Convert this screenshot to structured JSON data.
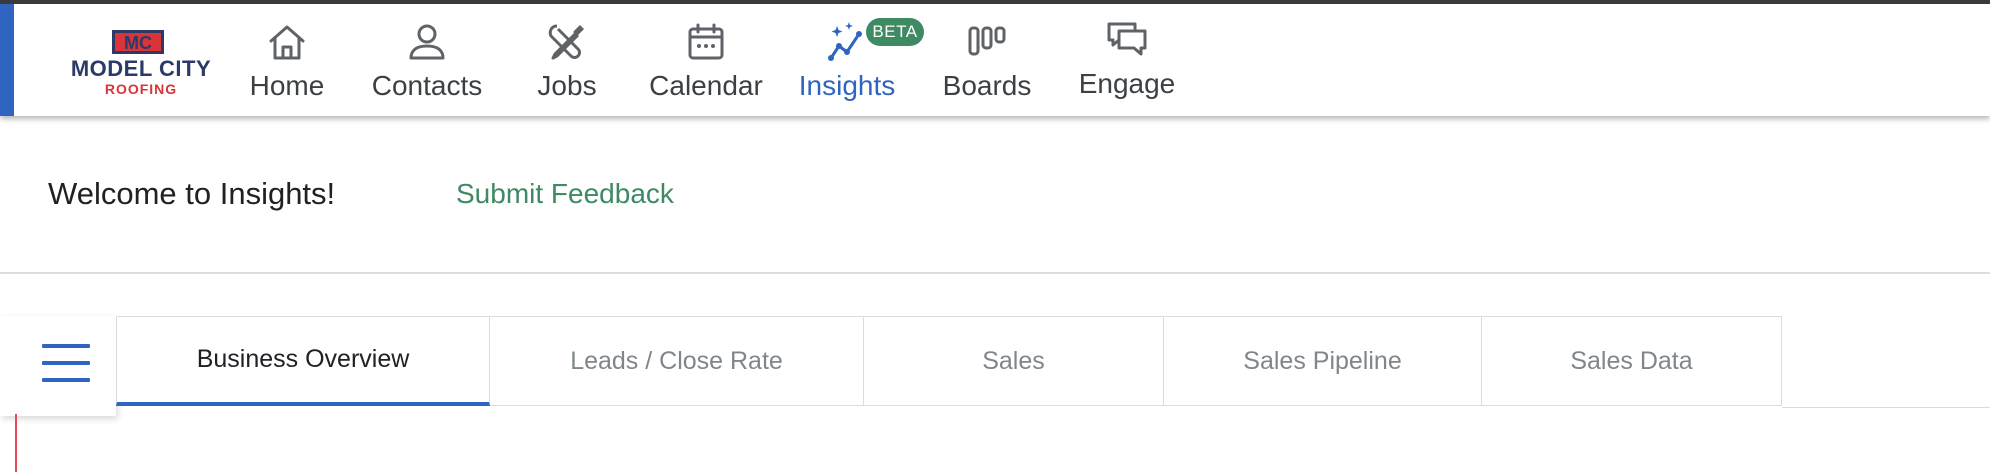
{
  "brand": {
    "logo_mark": "MC",
    "logo_line1": "MODEL CITY",
    "logo_line2": "ROOFING",
    "colors": {
      "navy": "#2b3a67",
      "red": "#d9343a"
    }
  },
  "nav": {
    "items": [
      {
        "label": "Home",
        "icon": "home-icon",
        "active": false
      },
      {
        "label": "Contacts",
        "icon": "person-icon",
        "active": false
      },
      {
        "label": "Jobs",
        "icon": "tools-icon",
        "active": false
      },
      {
        "label": "Calendar",
        "icon": "calendar-icon",
        "active": false
      },
      {
        "label": "Insights",
        "icon": "insights-sparkle-icon",
        "active": true
      },
      {
        "label": "Boards",
        "icon": "boards-icon",
        "active": false
      },
      {
        "label": "Engage",
        "icon": "chat-bubbles-icon",
        "active": false
      }
    ],
    "beta_badge": "BETA"
  },
  "header": {
    "welcome": "Welcome to Insights!",
    "feedback_link": "Submit Feedback"
  },
  "tabs": [
    {
      "label": "Business Overview",
      "active": true
    },
    {
      "label": "Leads / Close Rate",
      "active": false
    },
    {
      "label": "Sales",
      "active": false
    },
    {
      "label": "Sales Pipeline",
      "active": false
    },
    {
      "label": "Sales Data",
      "active": false
    }
  ],
  "menu_icon": "hamburger-menu-icon",
  "colors": {
    "accent_blue": "#2f64c1",
    "feedback_green": "#3e8a63",
    "beta_green": "#3e8a63",
    "text_dark": "#202124",
    "text_muted": "#80868b"
  }
}
